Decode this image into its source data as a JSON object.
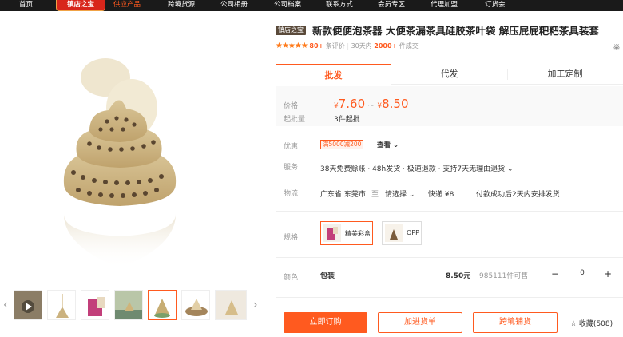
{
  "nav": {
    "items": [
      "首页",
      "供应产品",
      "跨境货源",
      "公司相册",
      "公司档案",
      "联系方式",
      "会员专区",
      "代理加盟",
      "订货会"
    ],
    "badge": "镇店之宝"
  },
  "product": {
    "shop_tag": "镇店之宝",
    "title": "新款便便泡茶器 大便茶漏茶具硅胶茶叶袋 解压屁屁粑粑茶具装套",
    "rating": {
      "stars": "★★★★★",
      "reviews_count": "80+",
      "reviews_label": "条评价",
      "sales_prefix": "30天内",
      "sales_count": "2000+",
      "sales_label": "件成交"
    },
    "edge_text": "举"
  },
  "tabs": [
    "批发",
    "代发",
    "加工定制"
  ],
  "price": {
    "label": "价格",
    "currency": "¥",
    "min": "7.60",
    "tilde": "~",
    "max": "8.50",
    "moq_label": "起批量",
    "moq_value": "3件起批"
  },
  "promo": {
    "label": "优惠",
    "tag": "满5000减200",
    "view_more": "查看 ⌄"
  },
  "service": {
    "label": "服务",
    "text": "38天免费赊账 · 48h发货 · 极速退款 · 支持7天无理由退货 ⌄"
  },
  "logistics": {
    "label": "物流",
    "from": "广东省 东莞市",
    "to_label": "至",
    "to_select": "请选择 ⌄",
    "express": "快递 ¥8",
    "delivery": "付款成功后2天内安排发货"
  },
  "spec": {
    "label": "规格",
    "options": [
      "精美彩盒",
      "OPP"
    ]
  },
  "color": {
    "label": "颜色",
    "name": "包装",
    "price": "8.50元",
    "stock": "985111件可售",
    "minus": "−",
    "qty": "0",
    "plus": "+"
  },
  "actions": {
    "order": "立即订购",
    "add_list": "加进货单",
    "cross_border": "跨境铺货",
    "favorite": "☆ 收藏(508)"
  },
  "gallery": {
    "prev": "‹",
    "next": "›"
  },
  "colors": {
    "accent": "#ff5a1f",
    "nav_bg": "#1a1a1a",
    "badge_bg": "#d8261b"
  }
}
